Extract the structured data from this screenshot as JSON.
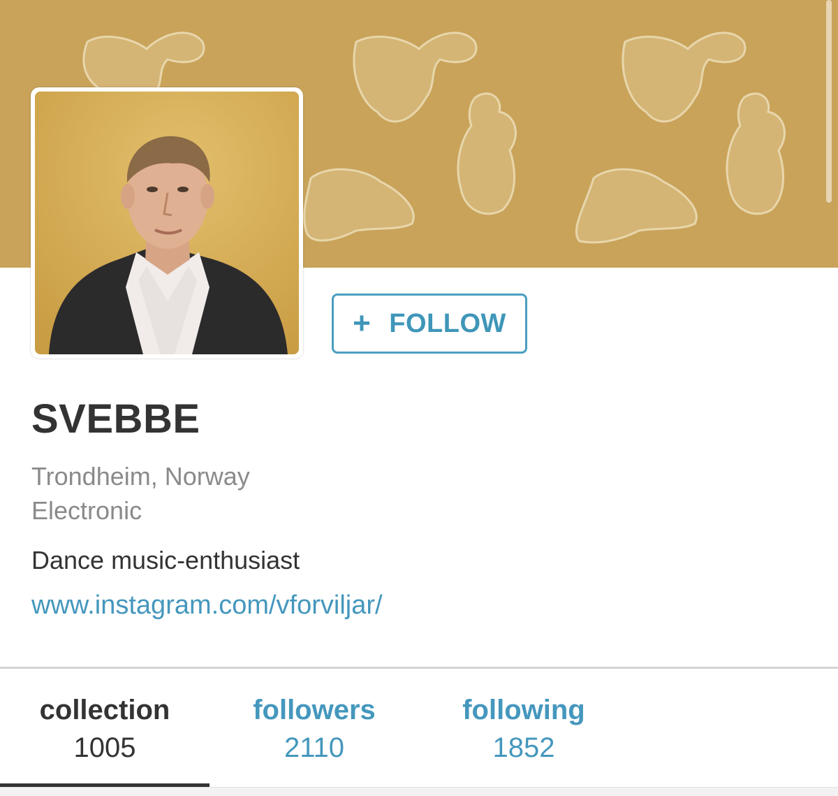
{
  "profile": {
    "follow_label": "FOLLOW",
    "follow_icon": "plus-icon",
    "name": "SVEBBE",
    "location": "Trondheim, Norway",
    "genre": "Electronic",
    "bio": "Dance music-enthusiast",
    "website": "www.instagram.com/vforviljar/"
  },
  "tabs": [
    {
      "label": "collection",
      "count": "1005",
      "active": true
    },
    {
      "label": "followers",
      "count": "2110",
      "active": false
    },
    {
      "label": "following",
      "count": "1852",
      "active": false
    }
  ],
  "colors": {
    "banner": "#c9a35a",
    "accent": "#4597bd",
    "text_dark": "#333333",
    "text_muted": "#8a8a8a"
  }
}
